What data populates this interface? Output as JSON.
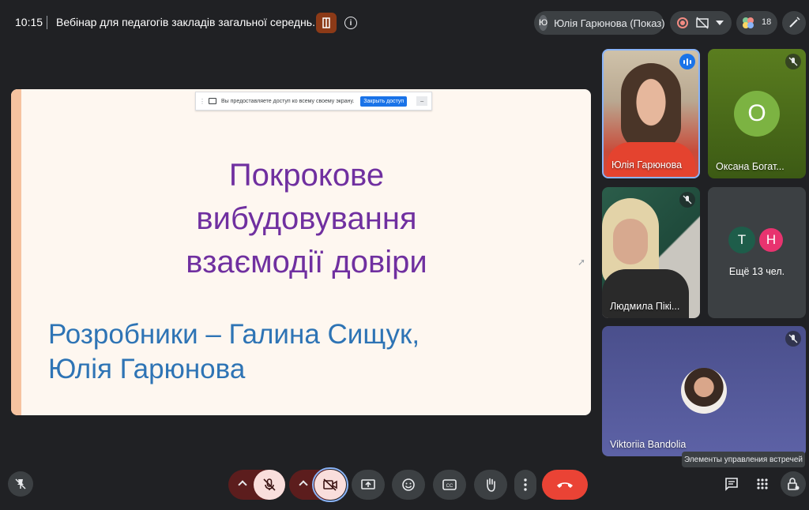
{
  "topbar": {
    "time": "10:15",
    "meeting_title": "Вебінар для педагогів закладів загальної середнь...",
    "presenter_initial": "Ю",
    "presenter_label": "Юлія Гарюнова (Показ)",
    "participant_count": "18"
  },
  "stage": {
    "share_banner_text": "Вы предоставляете доступ ко всему своему экрану.",
    "share_stop_button": "Закрыть доступ",
    "slide_title_lines": [
      "Покрокове",
      "вибудовування",
      "взаємодії довіри"
    ],
    "slide_authors_lines": [
      "Розробники – Галина Сищук,",
      "Юлія Гарюнова"
    ]
  },
  "tiles": {
    "yulia": {
      "name": "Юлія Гарюнова"
    },
    "oksana": {
      "initial": "O",
      "name": "Оксана Богат..."
    },
    "lyudmila": {
      "name": "Людмила Пікі..."
    },
    "more": {
      "avatar1": "T",
      "avatar2": "H",
      "label": "Ещё 13 чел."
    },
    "viktoriia": {
      "name": "Viktoriia Bandolia"
    }
  },
  "tooltip": "Элементы управления встречей",
  "colors": {
    "end_call": "#ea4335",
    "slide_title": "#7030a0",
    "slide_authors": "#2e74b5",
    "speaking_blue": "#1a73e8"
  }
}
